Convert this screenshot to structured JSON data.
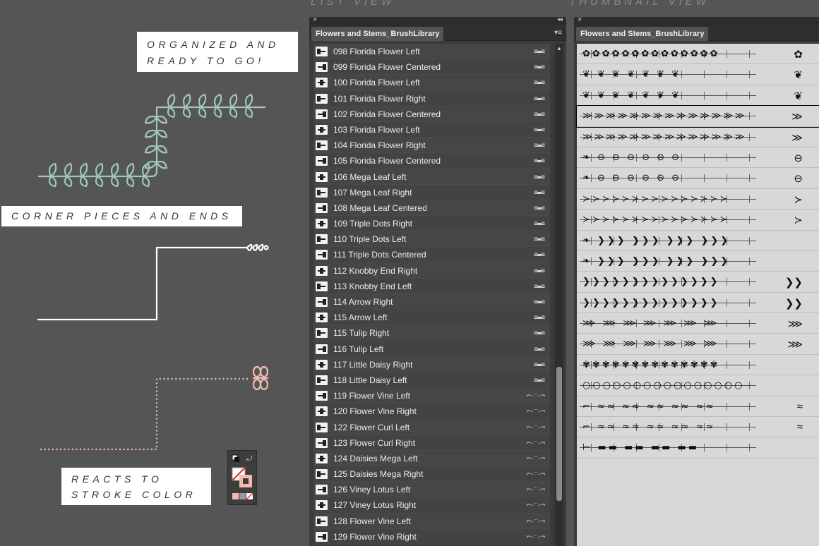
{
  "headings": {
    "list_view": "LIST VIEW",
    "thumbnail_view": "THUMBNAIL VIEW"
  },
  "captions": {
    "organized_line1": "ORGANIZED AND",
    "organized_line2": "READY TO GO!",
    "corner_pieces": "CORNER PIECES AND ENDS",
    "reacts_line1": "REACTS TO",
    "reacts_line2": "STROKE COLOR"
  },
  "list_panel": {
    "close_label": "×",
    "collapse_label": "◂◂",
    "tab_label": "Flowers and Stems_BrushLibrary",
    "menu_label": "▾≡",
    "scroll_up_label": "▲",
    "brushes": [
      {
        "name": "098 Florida Flower Left",
        "type": "art"
      },
      {
        "name": "099 Florida Flower Centered",
        "type": "art"
      },
      {
        "name": "100 Florida Flower Left",
        "type": "art"
      },
      {
        "name": "101 Florida Flower Right",
        "type": "art"
      },
      {
        "name": "102 Florida Flower Centered",
        "type": "art"
      },
      {
        "name": "103 Florida Flower Left",
        "type": "art"
      },
      {
        "name": "104 Florida Flower Right",
        "type": "art"
      },
      {
        "name": "105 Florida Flower Centered",
        "type": "art"
      },
      {
        "name": "106 Mega Leaf Left",
        "type": "art"
      },
      {
        "name": "107 Mega Leaf Right",
        "type": "art"
      },
      {
        "name": "108 Mega Leaf Centered",
        "type": "art"
      },
      {
        "name": "109 Triple Dots Right",
        "type": "art"
      },
      {
        "name": "110 Triple Dots Left",
        "type": "art"
      },
      {
        "name": "111 Triple Dots Centered",
        "type": "art"
      },
      {
        "name": "112 Knobby End Right",
        "type": "art"
      },
      {
        "name": "113 Knobby End Left",
        "type": "art"
      },
      {
        "name": "114 Arrow Right",
        "type": "art"
      },
      {
        "name": "115 Arrow Left",
        "type": "art"
      },
      {
        "name": "115 Tulip Right",
        "type": "art"
      },
      {
        "name": "116 Tulip Left",
        "type": "art"
      },
      {
        "name": "117 Little Daisy Right",
        "type": "art"
      },
      {
        "name": "118 Little Daisy Left",
        "type": "art"
      },
      {
        "name": "119 Flower Vine Left",
        "type": "pattern"
      },
      {
        "name": "120 Flower Vine Right",
        "type": "pattern"
      },
      {
        "name": "122 Flower Curl Left",
        "type": "pattern"
      },
      {
        "name": "123 Flower Curl Right",
        "type": "pattern"
      },
      {
        "name": "124 Daisies Mega Left",
        "type": "pattern"
      },
      {
        "name": "125 Daisies Mega Right",
        "type": "pattern"
      },
      {
        "name": "126 Viney Lotus Left",
        "type": "pattern"
      },
      {
        "name": "127 Viney Lotus Right",
        "type": "pattern"
      },
      {
        "name": "128 Flower Vine Left",
        "type": "pattern"
      },
      {
        "name": "129 Flower Vine Right",
        "type": "pattern"
      }
    ]
  },
  "thumb_panel": {
    "close_label": "×",
    "tab_label": "Flowers and Stems_BrushLibrary",
    "rows": [
      {
        "motif": "✿✿✿✿✿✿✿✿✿✿✿✿✿✿",
        "end": "✿"
      },
      {
        "motif": "❦ ❦ ❦ ❦ ❦ ❦ ❦",
        "end": "❦"
      },
      {
        "motif": "❦ ❦ ❦ ❦ ❦ ❦ ❦",
        "end": "❦"
      },
      {
        "motif": "≫≫≫≫≫≫≫≫≫≫≫≫≫≫≫",
        "end": "≫"
      },
      {
        "motif": "≫≫≫≫≫≫≫≫≫≫≫≫≫≫≫",
        "end": "≫"
      },
      {
        "motif": "❧ ⊖ ⊖ ⊖ ⊖ ⊖ ⊖",
        "end": "⊖"
      },
      {
        "motif": "❧ ⊖ ⊖ ⊖ ⊖ ⊖ ⊖",
        "end": "⊖"
      },
      {
        "motif": "≻≻≻≻≻≻≻≻≻≻≻≻≻≻≻",
        "end": "≻"
      },
      {
        "motif": "≻≻≻≻≻≻≻≻≻≻≻≻≻≻≻",
        "end": "≻"
      },
      {
        "motif": "❧ ❯❯❯ ❯❯❯ ❯❯❯ ❯❯❯",
        "end": ""
      },
      {
        "motif": "❧ ❯❯❯ ❯❯❯ ❯❯❯ ❯❯❯",
        "end": ""
      },
      {
        "motif": "❯❯❯❯❯❯❯❯❯❯❯❯❯❯",
        "end": "❯❯"
      },
      {
        "motif": "❯❯❯❯❯❯❯❯❯❯❯❯❯❯",
        "end": "❯❯"
      },
      {
        "motif": "⋙ ⋙ ⋙ ⋙ ⋙ ⋙ ⋙",
        "end": "⋙"
      },
      {
        "motif": "⋙ ⋙ ⋙ ⋙ ⋙ ⋙ ⋙",
        "end": "⋙"
      },
      {
        "motif": "✾✾✾✾✾✾✾✾✾✾✾✾✾✾",
        "end": ""
      },
      {
        "motif": "○○○○○○○○○○○○○○○○",
        "end": ""
      },
      {
        "motif": "⌐ ≈≈ ≈≈ ≈≈ ≈≈ ≈≈",
        "end": "≈"
      },
      {
        "motif": "⌐ ≈≈ ≈≈ ≈≈ ≈≈ ≈≈",
        "end": "≈"
      },
      {
        "motif": "⊢ ▬▬ ▬▬ ▬▬ ▬▬",
        "end": ""
      }
    ]
  },
  "colors": {
    "background": "#555555",
    "vine_green": "#9fc8b7",
    "stroke_white": "#ffffff",
    "dotted_pink": "#f4b9b0"
  }
}
